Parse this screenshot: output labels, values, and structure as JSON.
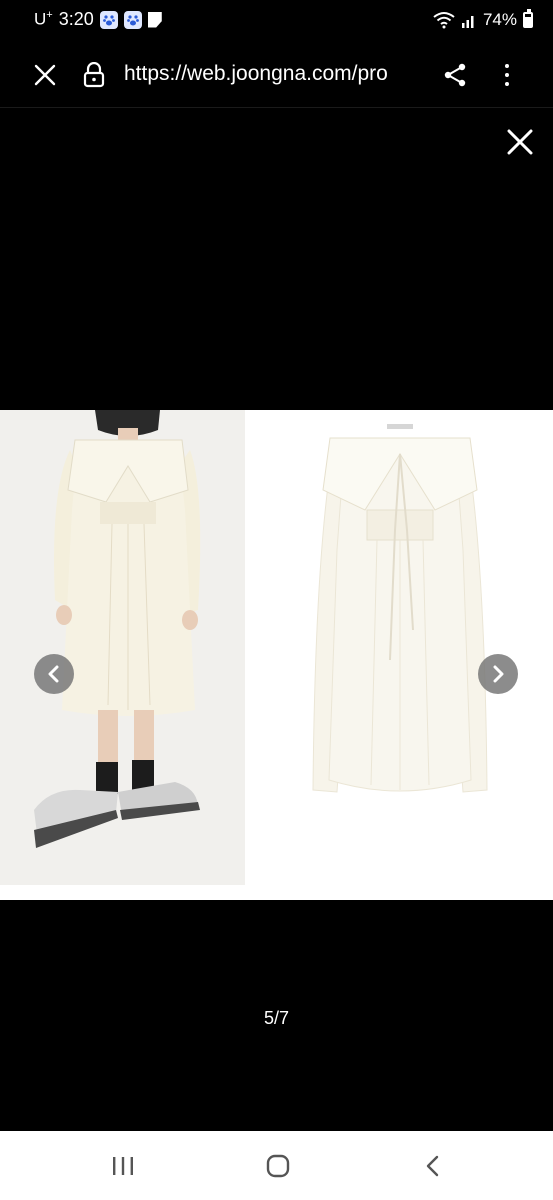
{
  "status": {
    "carrier": "U",
    "carrier_sup": "+",
    "time": "3:20",
    "battery": "74%",
    "battery_level": 0.74,
    "icons": [
      "paw-icon",
      "paw-icon",
      "document-icon",
      "wifi-icon",
      "signal-icon",
      "battery-icon"
    ]
  },
  "browser": {
    "url": "https://web.joongna.com/pro",
    "icons": [
      "close-icon",
      "lock-icon",
      "share-icon",
      "more-vertical-icon"
    ]
  },
  "gallery": {
    "counter": "5/7",
    "icons": [
      "close-icon",
      "chevron-left-icon",
      "chevron-right-icon"
    ]
  },
  "system_nav": {
    "icons": [
      "recents-icon",
      "home-icon",
      "back-icon"
    ]
  },
  "colors": {
    "background": "#000000",
    "system_nav_bg": "#ffffff",
    "nav_arrow_bg": "#787878",
    "dress_color": "#f6f2e4"
  }
}
